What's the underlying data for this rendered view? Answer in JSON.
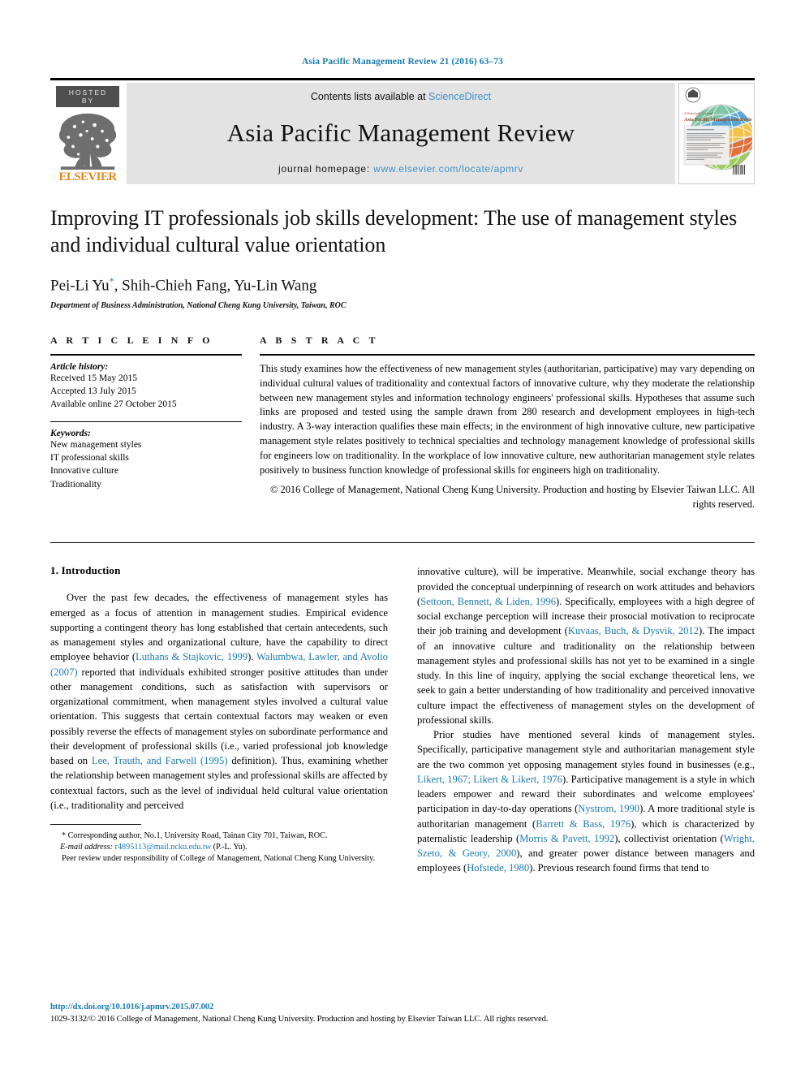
{
  "running_head": "Asia Pacific Management Review 21 (2016) 63–73",
  "masthead": {
    "hosted_by": "HOSTED BY",
    "publisher": "ELSEVIER",
    "contents_prefix": "Contents lists available at ",
    "contents_link": "ScienceDirect",
    "journal_title": "Asia Pacific Management Review",
    "homepage_prefix": "journal homepage: ",
    "homepage_url": "www.elsevier.com/locate/apmrv",
    "cover_kicker": "A Scholarly Journal",
    "cover_title": "Asia Pacific Management Review"
  },
  "article": {
    "title": "Improving IT professionals job skills development: The use of management styles and individual cultural value orientation",
    "authors": "Pei-Li Yu",
    "authors_rest": ", Shih-Chieh Fang, Yu-Lin Wang",
    "author_marker": "*",
    "affiliation": "Department of Business Administration, National Cheng Kung University, Taiwan, ROC"
  },
  "info": {
    "heading": "A R T I C L E   I N F O",
    "history_label": "Article history:",
    "history": [
      "Received 15 May 2015",
      "Accepted 13 July 2015",
      "Available online 27 October 2015"
    ],
    "keywords_label": "Keywords:",
    "keywords": [
      "New management styles",
      "IT professional skills",
      "Innovative culture",
      "Traditionality"
    ]
  },
  "abstract": {
    "heading": "A B S T R A C T",
    "text": "This study examines how the effectiveness of new management styles (authoritarian, participative) may vary depending on individual cultural values of traditionality and contextual factors of innovative culture, why they moderate the relationship between new management styles and information technology engineers' professional skills. Hypotheses that assume such links are proposed and tested using the sample drawn from 280 research and development employees in high-tech industry. A 3-way interaction qualifies these main effects; in the environment of high innovative culture, new participative management style relates positively to technical specialties and technology management knowledge of professional skills for engineers low on traditionality. In the workplace of low innovative culture, new authoritarian management style relates positively to business function knowledge of professional skills for engineers high on traditionality.",
    "copyright": "© 2016 College of Management, National Cheng Kung University. Production and hosting by Elsevier Taiwan LLC. All rights reserved."
  },
  "body": {
    "section_heading": "1.  Introduction",
    "left_p1_a": "Over the past few decades, the effectiveness of management styles has emerged as a focus of attention in management studies. Empirical evidence supporting a contingent theory has long established that certain antecedents, such as management styles and organizational culture, have the capability to direct employee behavior (",
    "left_ref1": "Luthans & Stajkovic, 1999",
    "left_p1_b": "). ",
    "left_ref2": "Walumbwa, Lawler, and Avolio (2007)",
    "left_p1_c": " reported that individuals exhibited stronger positive attitudes than under other management conditions, such as satisfaction with supervisors or organizational commitment, when management styles involved a cultural value orientation. This suggests that certain contextual factors may weaken or even possibly reverse the effects of management styles on subordinate performance and their development of professional skills (i.e., varied professional job knowledge based on ",
    "left_ref3": "Lee, Trauth, and Farwell (1995)",
    "left_p1_d": " definition). Thus, examining whether the relationship between management styles and professional skills are affected by contextual factors, such as the level of individual held cultural value orientation (i.e., traditionality and perceived",
    "right_p1_a": "innovative culture), will be imperative. Meanwhile, social exchange theory has provided the conceptual underpinning of research on work attitudes and behaviors (",
    "right_ref1": "Settoon, Bennett, & Liden, 1996",
    "right_p1_b": "). Specifically, employees with a high degree of social exchange perception will increase their prosocial motivation to reciprocate their job training and development (",
    "right_ref2": "Kuvaas, Buch, & Dysvik, 2012",
    "right_p1_c": "). The impact of an innovative culture and traditionality on the relationship between management styles and professional skills has not yet to be examined in a single study. In this line of inquiry, applying the social exchange theoretical lens, we seek to gain a better understanding of how traditionality and perceived innovative culture impact the effectiveness of management styles on the development of professional skills.",
    "right_p2_a": "Prior studies have mentioned several kinds of management styles. Specifically, participative management style and authoritarian management style are the two common yet opposing management styles found in businesses (e.g., ",
    "right_ref3": "Likert, 1967; Likert & Likert, 1976",
    "right_p2_b": "). Participative management is a style in which leaders empower and reward their subordinates and welcome employees' participation in day-to-day operations (",
    "right_ref4": "Nystrom, 1990",
    "right_p2_c": "). A more traditional style is authoritarian management (",
    "right_ref5": "Barrett & Bass, 1976",
    "right_p2_d": "), which is characterized by paternalistic leadership (",
    "right_ref6": "Morris & Pavett, 1992",
    "right_p2_e": "), collectivist orientation (",
    "right_ref7": "Wright, Szeto, & Geory, 2000",
    "right_p2_f": "), and greater power distance between managers and employees (",
    "right_ref8": "Hofstede, 1980",
    "right_p2_g": "). Previous research found firms that tend to"
  },
  "footnotes": {
    "corresponding_marker": "*",
    "corresponding": "Corresponding author, No.1, University Road, Tainan City 701, Taiwan, ROC.",
    "email_label": "E-mail address:",
    "email": "r4895113@mail.ncku.edu.tw",
    "email_suffix": "(P.-L. Yu).",
    "peer_review": "Peer review under responsibility of College of Management, National Cheng Kung University."
  },
  "footer": {
    "doi": "http://dx.doi.org/10.1016/j.apmrv.2015.07.002",
    "issn": "1029-3132/© 2016 College of Management, National Cheng Kung University. Production and hosting by Elsevier Taiwan LLC. All rights reserved."
  },
  "colors": {
    "link": "#1a7bb0",
    "masthead_link": "#3d90c7",
    "masthead_bg": "#e3e3e3",
    "elsevier_orange": "#e08a1e"
  }
}
